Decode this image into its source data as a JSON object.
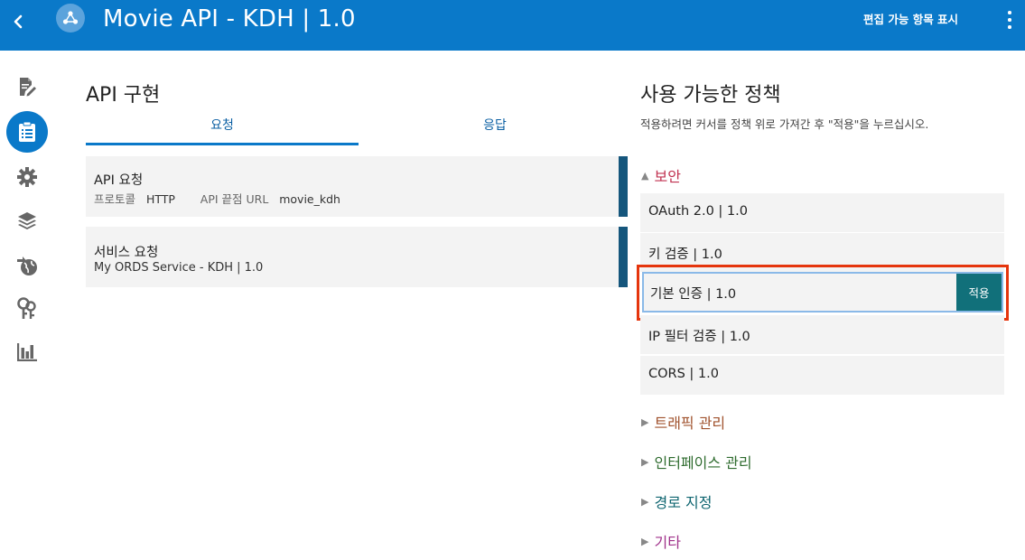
{
  "header": {
    "title": "Movie API - KDH | 1.0",
    "edit_label": "편집 가능 항목 표시",
    "bg_color": "#0a79c9"
  },
  "left_rail": {
    "items": [
      {
        "icon": "document-edit-icon"
      },
      {
        "icon": "clipboard-list-icon",
        "active": true
      },
      {
        "icon": "gear-icon"
      },
      {
        "icon": "layers-icon"
      },
      {
        "icon": "globe-icon"
      },
      {
        "icon": "keys-icon"
      },
      {
        "icon": "bar-chart-icon"
      }
    ]
  },
  "implementation": {
    "title": "API 구현",
    "tabs": [
      {
        "label": "요청",
        "active": true
      },
      {
        "label": "응답",
        "active": false
      }
    ],
    "cards": [
      {
        "name": "API 요청",
        "protocol_label": "프로토콜",
        "protocol_value": "HTTP",
        "endpoint_label": "API 끝점 URL",
        "endpoint_value": "movie_kdh"
      },
      {
        "name": "서비스 요청",
        "detail": "My ORDS Service - KDH | 1.0"
      }
    ]
  },
  "policies": {
    "title": "사용 가능한 정책",
    "description": "적용하려면 커서를 정책 위로 가져간 후 \"적용\"을 누르십시오.",
    "groups": [
      {
        "label": "보안",
        "expanded": true,
        "color": "#c0304f"
      },
      {
        "label": "트래픽 관리",
        "expanded": false,
        "color": "#a0522d"
      },
      {
        "label": "인터페이스 관리",
        "expanded": false,
        "color": "#2e6b2e"
      },
      {
        "label": "경로 지정",
        "expanded": false,
        "color": "#0e6570"
      },
      {
        "label": "기타",
        "expanded": false,
        "color": "#a0308a"
      }
    ],
    "security_items": [
      {
        "label": "OAuth 2.0 | 1.0"
      },
      {
        "label": "키 검증 | 1.0"
      },
      {
        "label": "기본 인증 | 1.0",
        "highlighted": true
      },
      {
        "label": "IP 필터 검증 | 1.0"
      },
      {
        "label": "CORS | 1.0"
      }
    ],
    "apply_label": "적용"
  }
}
